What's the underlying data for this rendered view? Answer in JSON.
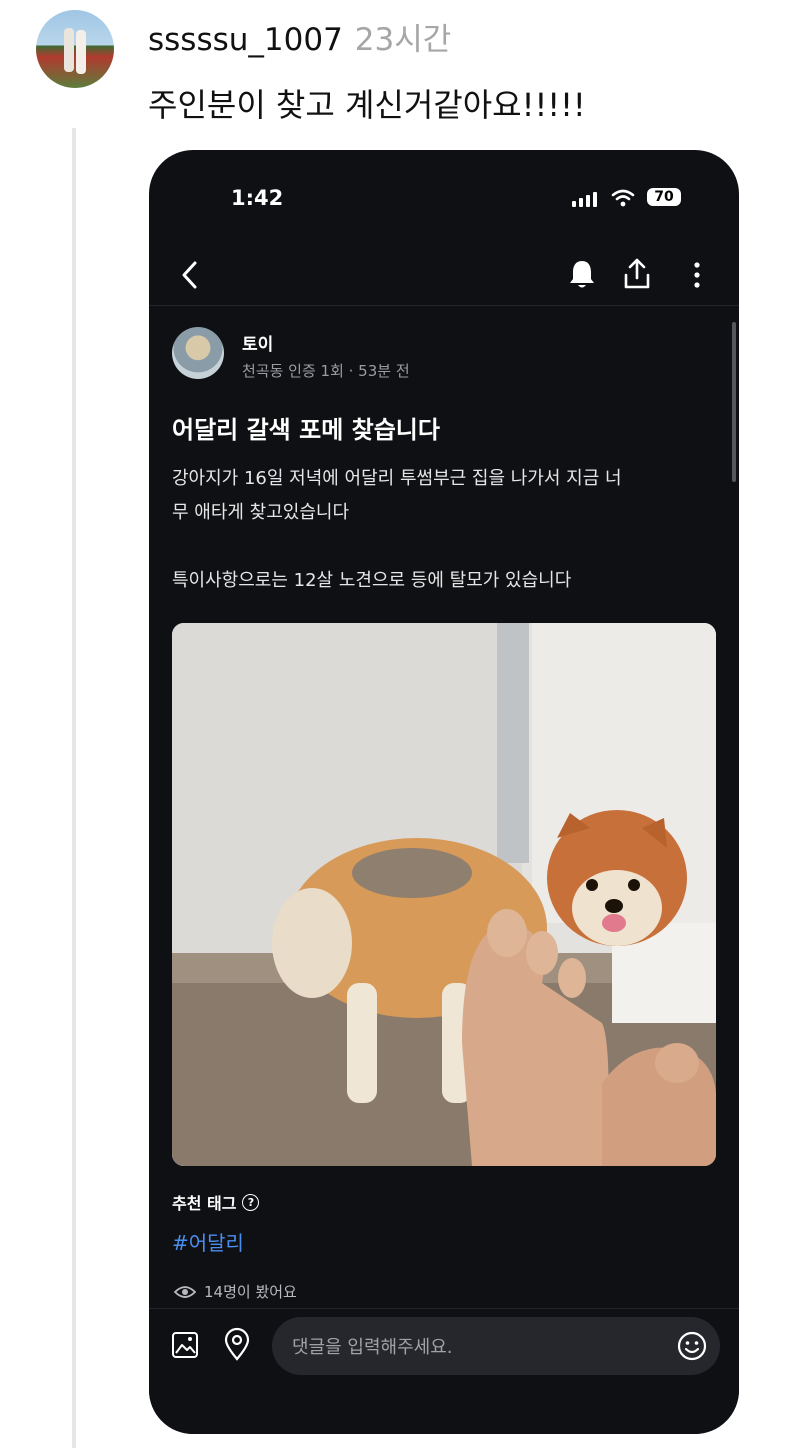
{
  "reply": {
    "username": "sssssu_1007",
    "time": "23시간",
    "text": "주인분이 찾고 계신거같아요!!!!!"
  },
  "phone": {
    "status": {
      "time": "1:42",
      "battery": "70"
    },
    "nav": {
      "icons": [
        "chevron-left-icon",
        "bell-icon",
        "share-icon",
        "more-vertical-icon"
      ]
    },
    "post": {
      "author": "토이",
      "meta": "천곡동 인증 1회 · 53분 전",
      "title": "어달리 갈색 포메 찾습니다",
      "body": [
        "강아지가 16일 저녁에 어달리 투썸부근 집을 나가서 지금 너",
        "무 애타게 찾고있습니다",
        "특이사항으로는 12살 노견으로 등에 탈모가 있습니다"
      ],
      "tag_label": "추천 태그",
      "tag": "#어달리",
      "views": "14명이 봤어요"
    },
    "comment": {
      "placeholder": "댓글을 입력해주세요."
    }
  },
  "colors": {
    "phone_bg": "#0f1013",
    "hashtag": "#4a8ef0",
    "input_bg": "#25272c"
  }
}
